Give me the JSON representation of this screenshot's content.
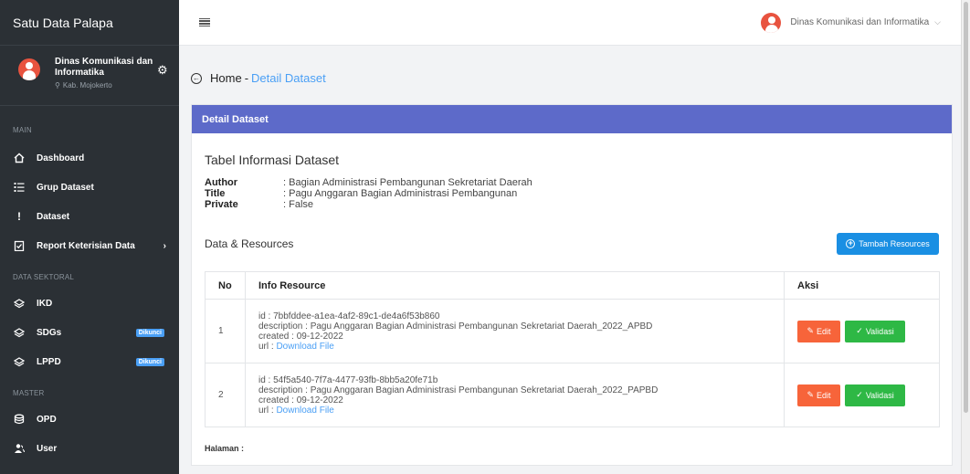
{
  "app": {
    "title": "Satu Data Palapa"
  },
  "profile": {
    "name": "Dinas Komunikasi dan Informatika",
    "location": "Kab. Mojokerto"
  },
  "sidebar": {
    "sections": [
      {
        "label": "MAIN",
        "items": [
          {
            "label": "Dashboard",
            "icon": "home-icon"
          },
          {
            "label": "Grup Dataset",
            "icon": "list-icon"
          },
          {
            "label": "Dataset",
            "icon": "exclamation-icon"
          },
          {
            "label": "Report Keterisian Data",
            "icon": "clipboard-check-icon",
            "chevron": "›"
          }
        ]
      },
      {
        "label": "DATA SEKTORAL",
        "items": [
          {
            "label": "IKD",
            "icon": "layers-icon"
          },
          {
            "label": "SDGs",
            "icon": "layers-icon",
            "badge": "Dikunci"
          },
          {
            "label": "LPPD",
            "icon": "layers-icon",
            "badge": "Dikunci"
          }
        ]
      },
      {
        "label": "MASTER",
        "items": [
          {
            "label": "OPD",
            "icon": "database-icon"
          },
          {
            "label": "User",
            "icon": "users-icon"
          }
        ]
      }
    ]
  },
  "topbar": {
    "user_name": "Dinas Komunikasi dan Informatika"
  },
  "breadcrumb": {
    "home": "Home",
    "separator": "-",
    "current": "Detail Dataset"
  },
  "card": {
    "header": "Detail Dataset",
    "title": "Tabel Informasi Dataset",
    "info": [
      {
        "key": "Author",
        "value": ": Bagian Administrasi Pembangunan Sekretariat Daerah"
      },
      {
        "key": "Title",
        "value": ": Pagu Anggaran Bagian Administrasi Pembangunan"
      },
      {
        "key": "Private",
        "value": ": False"
      }
    ],
    "resources_title": "Data & Resources",
    "add_button": "Tambah Resources",
    "table": {
      "headers": [
        "No",
        "Info Resource",
        "Aksi"
      ],
      "rows": [
        {
          "no": "1",
          "id": "id : 7bbfddee-a1ea-4af2-89c1-de4a6f53b860",
          "description": "description : Pagu Anggaran Bagian Administrasi Pembangunan Sekretariat Daerah_2022_APBD",
          "created": "created : 09-12-2022",
          "url_label": "url : ",
          "url_link": "Download File"
        },
        {
          "no": "2",
          "id": "id : 54f5a540-7f7a-4477-93fb-8bb5a20fe71b",
          "description": "description : Pagu Anggaran Bagian Administrasi Pembangunan Sekretariat Daerah_2022_PAPBD",
          "created": "created : 09-12-2022",
          "url_label": "url : ",
          "url_link": "Download File"
        }
      ],
      "edit_label": "Edit",
      "validate_label": "Validasi"
    },
    "pagination_label": "Halaman :"
  },
  "colors": {
    "sidebar": "#2b3035",
    "header": "#5d6ac9",
    "primary": "#1a8fe3",
    "edit": "#f7643a",
    "validate": "#2eb845",
    "link": "#4a9ff5"
  }
}
